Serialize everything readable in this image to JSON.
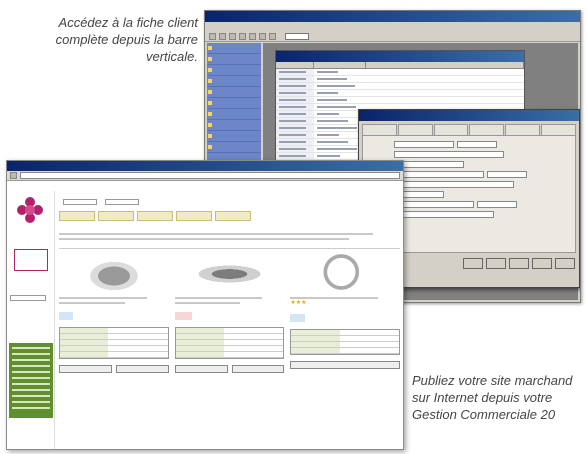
{
  "captions": {
    "top": "Accédez à la fiche client complète depuis la barre verticale.",
    "bottom": "Publiez votre site marchand sur Internet depuis votre Gestion Commerciale 20"
  }
}
